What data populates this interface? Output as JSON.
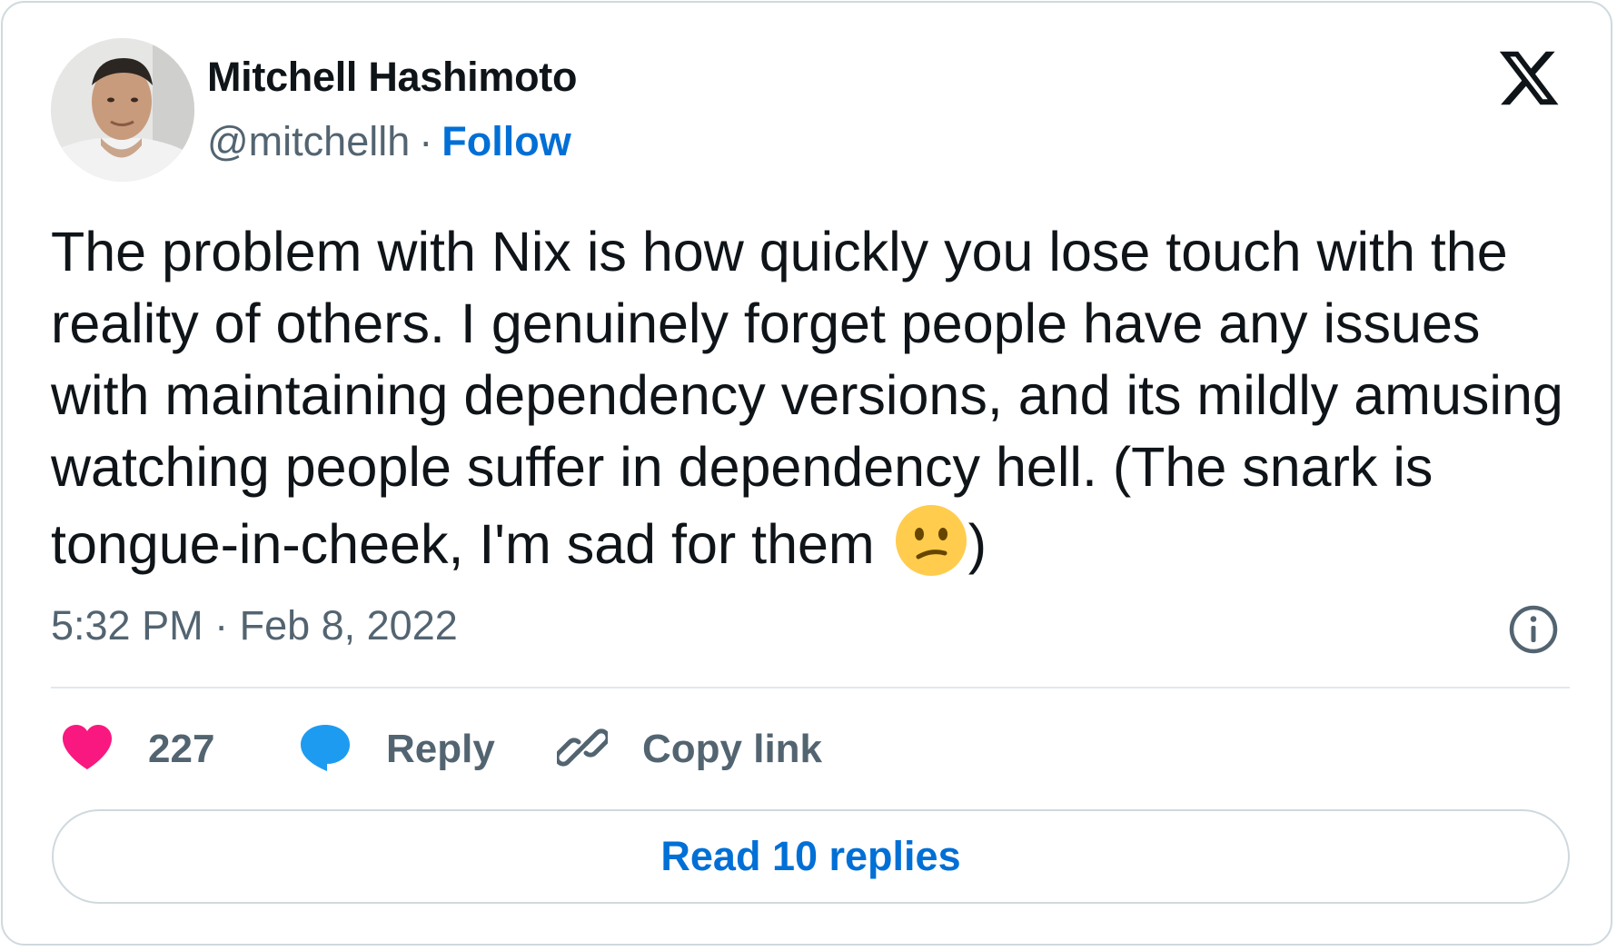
{
  "author": {
    "name": "Mitchell Hashimoto",
    "handle": "@mitchellh",
    "separator": "·",
    "follow_label": "Follow"
  },
  "platform_logo": "x-logo-icon",
  "tweet": {
    "text": "The problem with Nix is how quickly you lose touch with the reality of others. I genuinely forget people have any issues with maintaining dependency versions, and its mildly amusing watching people suffer in dependency hell. (The snark is tongue-in-cheek, I'm sad for them ",
    "text_end": ")",
    "emoji": "confused-face-emoji",
    "timestamp": "5:32 PM · Feb 8, 2022"
  },
  "actions": {
    "like_count": "227",
    "reply_label": "Reply",
    "copy_link_label": "Copy link"
  },
  "read_replies_label": "Read 10 replies",
  "colors": {
    "text_primary": "#0f1419",
    "text_secondary": "#536471",
    "link": "#006fd6",
    "like": "#f91880",
    "reply": "#1d9bf0",
    "border": "#cfd9de"
  }
}
